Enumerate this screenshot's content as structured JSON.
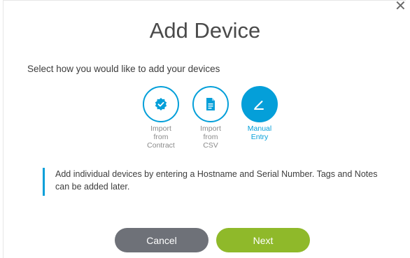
{
  "dialog": {
    "title": "Add Device",
    "close_symbol": "✕",
    "subtitle": "Select how you would like to add your devices"
  },
  "options": [
    {
      "label": "Import\nfrom\nContract",
      "icon": "verified-badge-icon",
      "selected": false
    },
    {
      "label": "Import\nfrom\nCSV",
      "icon": "document-icon",
      "selected": false
    },
    {
      "label": "Manual\nEntry",
      "icon": "pencil-icon",
      "selected": true
    }
  ],
  "info": {
    "text": "Add individual devices by entering a Hostname and Serial Number. Tags and Notes can be added later."
  },
  "buttons": {
    "cancel": "Cancel",
    "next": "Next"
  },
  "colors": {
    "accent": "#049fd9",
    "cancel_bg": "#6e7178",
    "next_bg": "#8fb92a"
  }
}
